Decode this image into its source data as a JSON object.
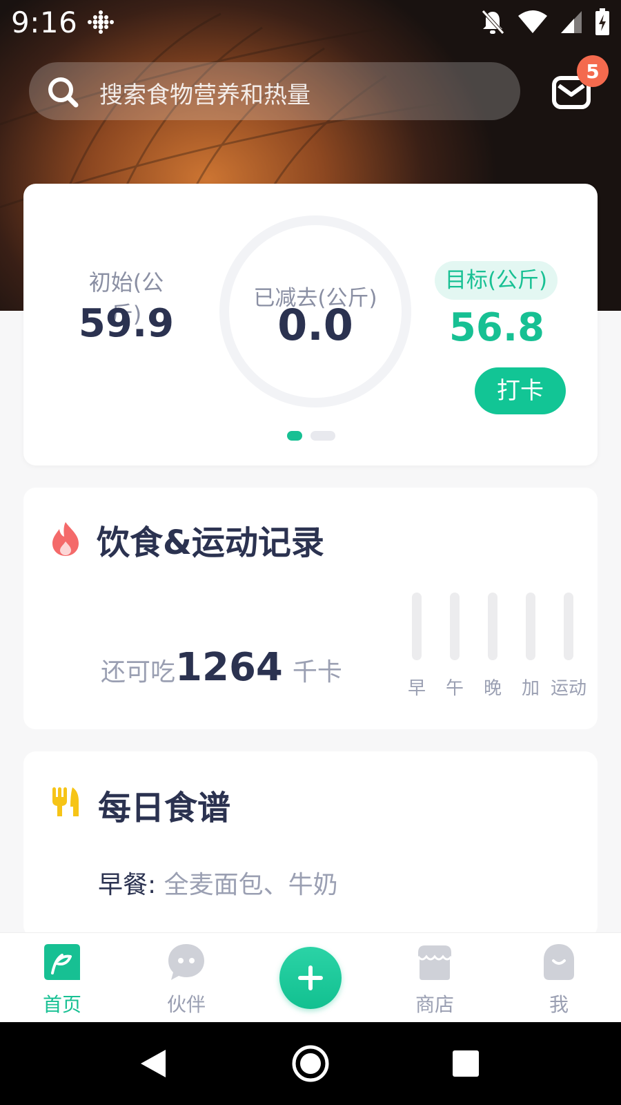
{
  "status_bar": {
    "time": "9:16"
  },
  "search": {
    "placeholder": "搜索食物营养和热量"
  },
  "messages": {
    "badge_count": "5"
  },
  "weight_card": {
    "initial_label": "初始(公斤)",
    "initial_value": "59.9",
    "lost_label": "已减去(公斤)",
    "lost_value": "0.0",
    "target_label": "目标(公斤)",
    "target_value": "56.8",
    "checkin_button": "打卡",
    "progress_fraction": 0.0
  },
  "diet_card": {
    "title": "饮食&运动记录",
    "remaining_prefix": "还可吃",
    "remaining_kcal": "1264",
    "kcal_unit": "千卡",
    "bars": [
      {
        "label": "早",
        "fraction": 0
      },
      {
        "label": "午",
        "fraction": 0
      },
      {
        "label": "晚",
        "fraction": 0
      },
      {
        "label": "加",
        "fraction": 0
      },
      {
        "label": "运动",
        "fraction": 0
      }
    ]
  },
  "recipe_card": {
    "title": "每日食谱",
    "meal_label": "早餐:",
    "meal_items": " 全麦面包、牛奶"
  },
  "bottom_nav": {
    "items": [
      {
        "label": "首页",
        "icon": "leaf-home-icon",
        "active": true
      },
      {
        "label": "伙伴",
        "icon": "chat-bubble-icon",
        "active": false
      },
      {
        "label": "",
        "icon": "plus-icon",
        "active": false
      },
      {
        "label": "商店",
        "icon": "store-icon",
        "active": false
      },
      {
        "label": "我",
        "icon": "person-icon",
        "active": false
      }
    ]
  },
  "colors": {
    "accent": "#17c093",
    "text_dark": "#2b3250",
    "text_muted": "#9a9fb2",
    "badge": "#f46a4e",
    "fire": "#f46a6a",
    "fork": "#f6c417"
  }
}
